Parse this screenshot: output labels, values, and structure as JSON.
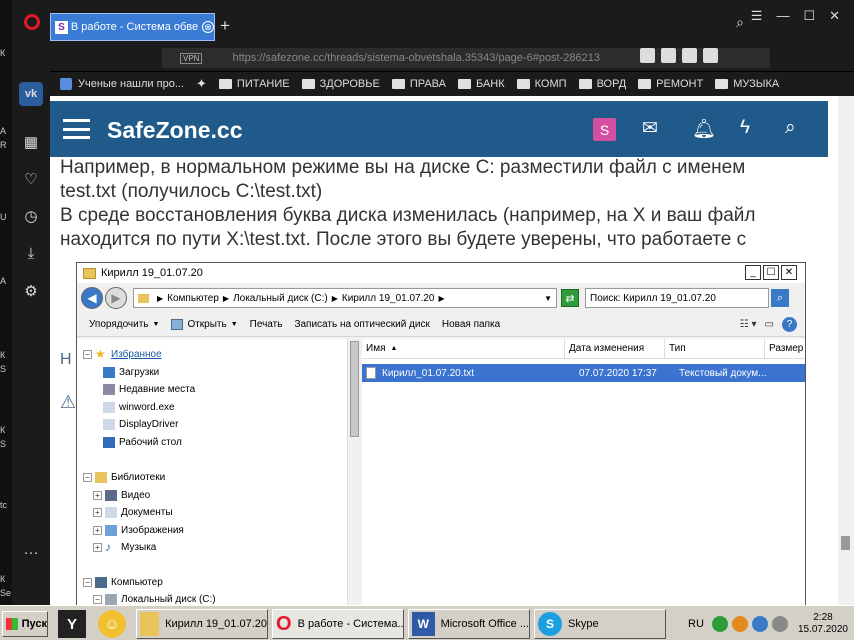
{
  "left_strip": {
    "fragments": [
      "К",
      "А",
      "R",
      "U",
      "А",
      "К",
      "S",
      "К",
      "S",
      "tc",
      "К",
      "Se",
      "К"
    ]
  },
  "browser": {
    "tab": {
      "favicon": "S",
      "title": "В работе - Система обветшала",
      "close": "⊗"
    },
    "new_tab": "+",
    "vpn_label": "VPN",
    "url": "https://safezone.cc/threads/sistema-obvetshala.35343/page-6#post-286213",
    "window_controls": [
      "☰",
      "—",
      "☐",
      "✕"
    ],
    "bookmarks": [
      "Ученые нашли про...",
      "ПИТАНИЕ",
      "ЗДОРОВЬЕ",
      "ПРАВА",
      "БАНК",
      "КОМП",
      "ВОРД",
      "РЕМОНТ",
      "МУЗЫКА"
    ]
  },
  "site": {
    "logo": "SafeZone.cc",
    "avatar": "S",
    "paragraphs": [
      "Например, в нормальном режиме вы на диске С: разместили файл с именем test.txt (получилось С:\\test.txt)",
      "В среде восстановления буква диска изменилась (например, на X и ваш файл находится по пути X:\\test.txt. После этого вы будете уверены, что работаете с"
    ],
    "fragments": [
      "с",
      "Н",
      "⚠"
    ]
  },
  "explorer": {
    "title": "Кирилл 19_01.07.20",
    "window_buttons": [
      "_",
      "☐",
      "✕"
    ],
    "breadcrumb": [
      "Компьютер",
      "Локальный диск (C:)",
      "Кирилл 19_01.07.20"
    ],
    "search_placeholder": "Поиск: Кирилл 19_01.07.20",
    "toolbar": [
      "Упорядочить",
      "Открыть",
      "Печать",
      "Записать на оптический диск",
      "Новая папка"
    ],
    "tree": {
      "favorites": "Избранное",
      "favorites_items": [
        "Загрузки",
        "Недавние места",
        "winword.exe",
        "DisplayDriver",
        "Рабочий стол"
      ],
      "libraries": "Библиотеки",
      "libraries_items": [
        "Видео",
        "Документы",
        "Изображения",
        "Музыка"
      ],
      "computer": "Компьютер",
      "computer_items": [
        "Локальный диск (C:)"
      ]
    },
    "columns": [
      "Имя",
      "Дата изменения",
      "Тип",
      "Размер"
    ],
    "files": [
      {
        "name": "Кирилл_01.07.20.txt",
        "date": "07.07.2020 17:37",
        "type": "Текстовый докум..."
      }
    ]
  },
  "taskbar": {
    "start": "Пуск",
    "tasks": [
      "Кирилл 19_01.07.20",
      "В работе - Система...",
      "Microsoft Office ...",
      "Skype"
    ],
    "lang": "RU",
    "time": "2:28",
    "date": "15.07.2020"
  }
}
